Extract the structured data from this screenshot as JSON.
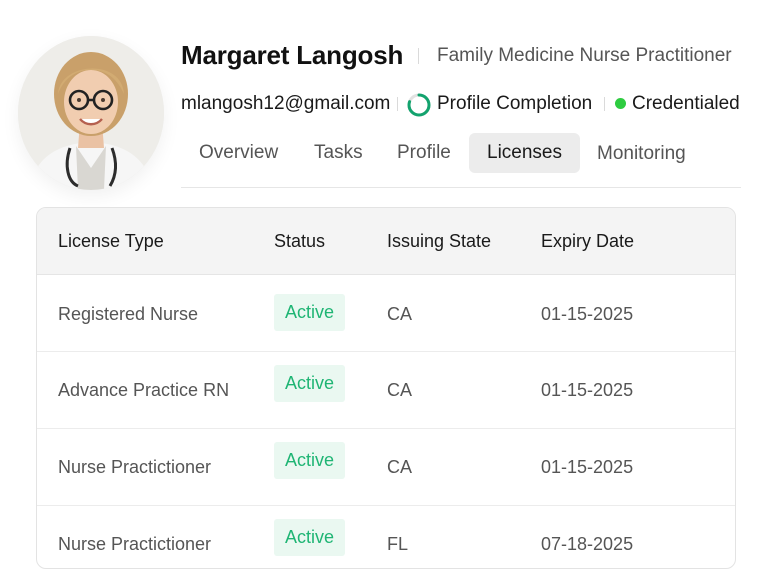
{
  "profile": {
    "name": "Margaret Langosh",
    "role": "Family Medicine Nurse Practitioner",
    "email": "mlangosh12@gmail.com",
    "completion_label": "Profile Completion",
    "completion_fraction": 0.8,
    "credential_status": "Credentialed",
    "accent_green": "#1fb574",
    "ring_color": "#13a36e",
    "credential_dot_color": "#2ecc40"
  },
  "tabs": [
    {
      "label": "Overview"
    },
    {
      "label": "Tasks"
    },
    {
      "label": "Profile"
    },
    {
      "label": "Licenses",
      "active": true
    },
    {
      "label": "Monitoring"
    }
  ],
  "table": {
    "headers": [
      "License Type",
      "Status",
      "Issuing State",
      "Expiry Date"
    ],
    "rows": [
      {
        "type": "Registered Nurse",
        "status": "Active",
        "state": "CA",
        "expiry": "01-15-2025"
      },
      {
        "type": "Advance Practice RN",
        "status": "Active",
        "state": "CA",
        "expiry": "01-15-2025"
      },
      {
        "type": "Nurse Practictioner",
        "status": "Active",
        "state": "CA",
        "expiry": "01-15-2025"
      },
      {
        "type": "Nurse Practictioner",
        "status": "Active",
        "state": "FL",
        "expiry": "07-18-2025"
      }
    ]
  }
}
